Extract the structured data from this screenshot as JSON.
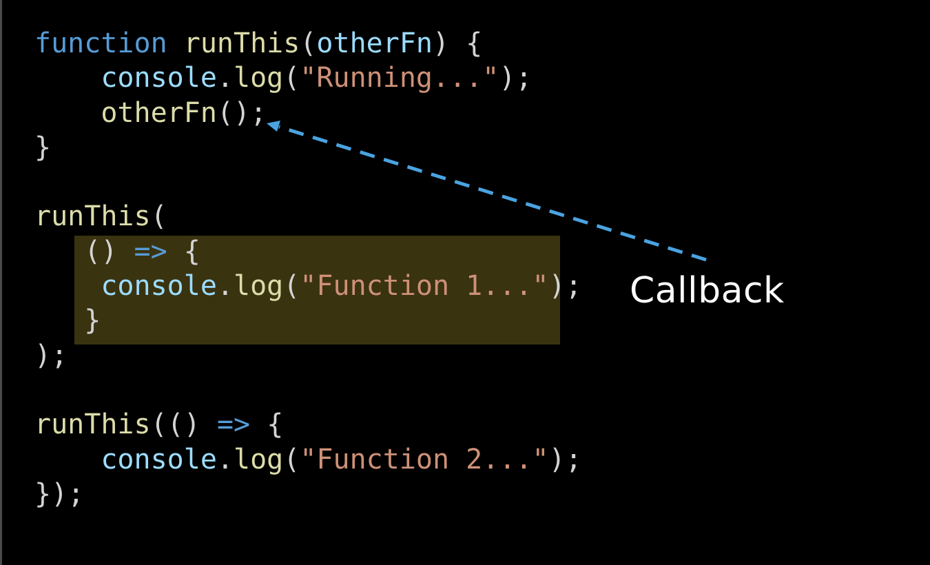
{
  "code": {
    "l1": {
      "kw": "function",
      "name": "runThis",
      "open": "(",
      "param": "otherFn",
      "close": ") {"
    },
    "l2": {
      "indent": "    ",
      "obj": "console",
      "dot": ".",
      "method": "log",
      "open": "(",
      "str": "\"Running...\"",
      "close": ");"
    },
    "l3": {
      "indent": "    ",
      "call": "otherFn",
      "close": "();"
    },
    "l4": {
      "brace": "}"
    },
    "l6": {
      "call": "runThis",
      "open": "("
    },
    "l7": {
      "indent": "   ",
      "paren": "()",
      "arrow": "=>",
      "brace": "{"
    },
    "l8": {
      "indent": "    ",
      "obj": "console",
      "dot": ".",
      "method": "log",
      "open": "(",
      "str": "\"Function 1...\"",
      "close": ");"
    },
    "l9": {
      "indent": "   ",
      "brace": "}"
    },
    "l10": {
      "close": ");"
    },
    "l12": {
      "call": "runThis",
      "open": "((",
      "paren": ")",
      "arrow": "=>",
      "brace": "{"
    },
    "l13": {
      "indent": "    ",
      "obj": "console",
      "dot": ".",
      "method": "log",
      "open": "(",
      "str": "\"Function 2...\"",
      "close": ");"
    },
    "l14": {
      "close": "});"
    }
  },
  "annotation": {
    "label": "Callback",
    "arrow_color": "#4aa3e0"
  },
  "colors": {
    "background": "#000000",
    "keyword": "#569cd6",
    "function_name": "#dcdcaa",
    "variable": "#9cdcfe",
    "string": "#ce9178",
    "highlight": "#3a3310"
  }
}
